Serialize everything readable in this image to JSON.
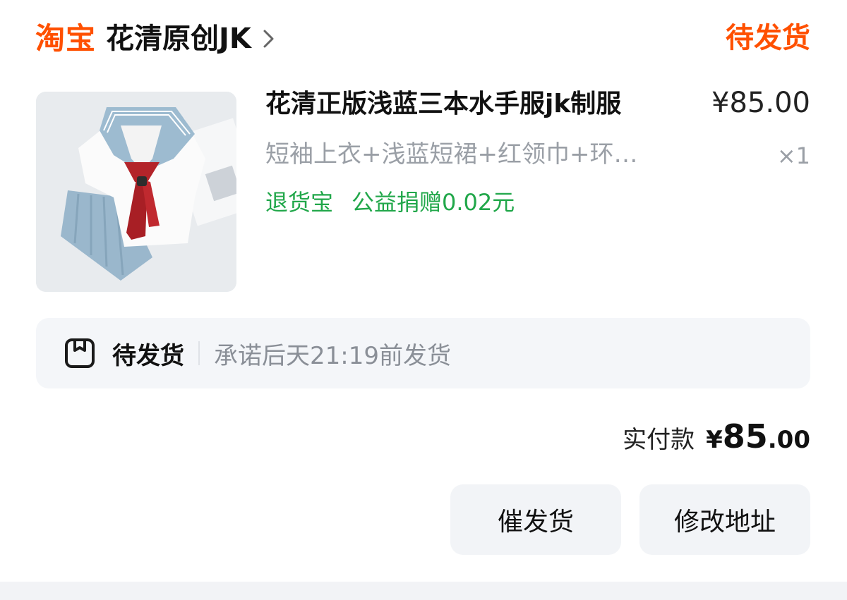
{
  "header": {
    "brand": "淘宝",
    "shop_name": "花清原创JK",
    "status": "待发货"
  },
  "product": {
    "title": "花清正版浅蓝三本水手服jk制服",
    "price": "¥85.00",
    "spec": "短袖上衣+浅蓝短裙+红领巾+环…",
    "quantity": "×1",
    "tags": [
      "退货宝",
      "公益捐赠0.02元"
    ]
  },
  "shipping": {
    "label": "待发货",
    "note": "承诺后天21:19前发货"
  },
  "total": {
    "label": "实付款",
    "currency": "¥",
    "integer": "85",
    "decimal": ".00"
  },
  "actions": {
    "urge_label": "催发货",
    "address_label": "修改地址"
  },
  "colors": {
    "brand": "#ff5000",
    "tag_green": "#21a74a",
    "muted": "#9a9fa6",
    "button_bg": "#f2f4f7"
  }
}
